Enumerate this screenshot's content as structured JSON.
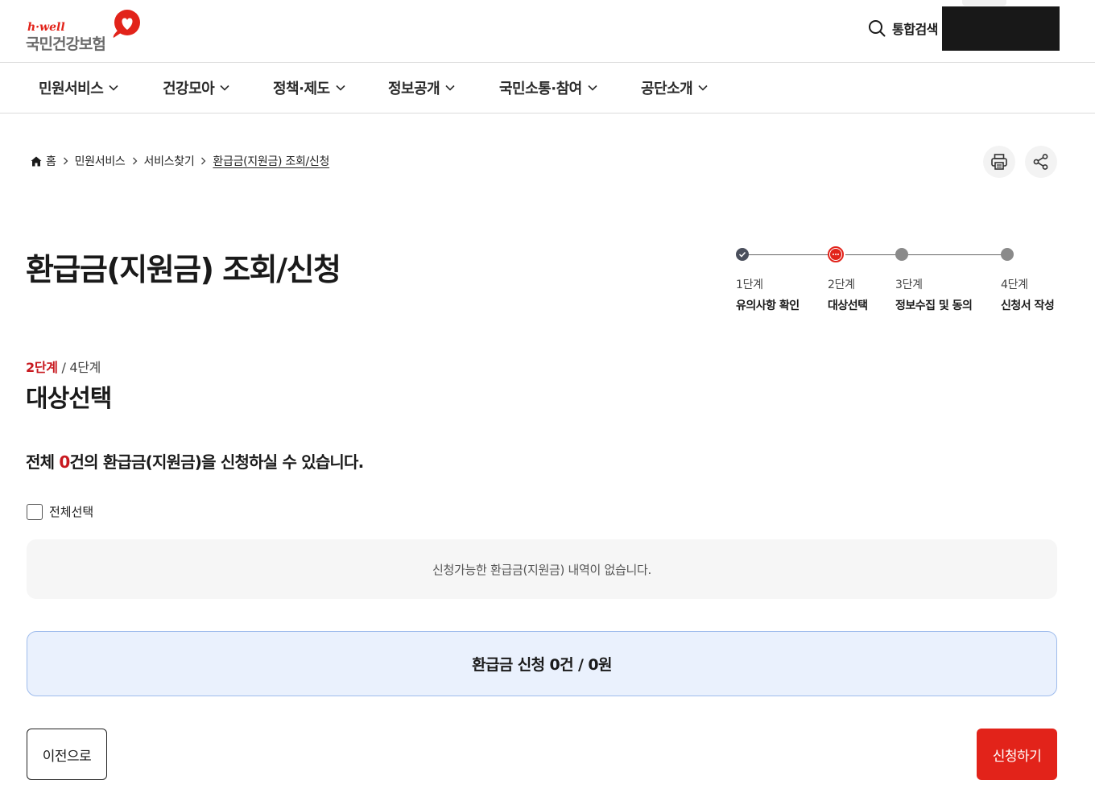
{
  "header": {
    "logo_en": "h·well",
    "logo_ko": "국민건강보험",
    "search_label": "통합검색",
    "accent_color": "#e2231a"
  },
  "gnb": {
    "items": [
      {
        "label": "민원서비스"
      },
      {
        "label": "건강모아"
      },
      {
        "label": "정책·제도"
      },
      {
        "label": "정보공개"
      },
      {
        "label": "국민소통·참여"
      },
      {
        "label": "공단소개"
      }
    ]
  },
  "breadcrumb": {
    "items": [
      "홈",
      "민원서비스",
      "서비스찾기",
      "환급금(지원금) 조회/신청"
    ]
  },
  "page": {
    "title": "환급금(지원금) 조회/신청"
  },
  "stepper": {
    "steps": [
      {
        "num": "1단계",
        "name": "유의사항 확인",
        "state": "done"
      },
      {
        "num": "2단계",
        "name": "대상선택",
        "state": "current"
      },
      {
        "num": "3단계",
        "name": "정보수집 및 동의",
        "state": "todo"
      },
      {
        "num": "4단계",
        "name": "신청서 작성",
        "state": "todo"
      }
    ]
  },
  "section": {
    "current_step": "2단계",
    "total_steps": " / 4단계",
    "title": "대상선택",
    "summary_prefix": "전체 ",
    "summary_count": "0",
    "summary_suffix": "건의 환급금(지원금)을 신청하실 수 있습니다.",
    "select_all_label": "전체선택",
    "empty_message": "신청가능한 환급금(지원금) 내역이 없습니다.",
    "total_text": "환급금 신청 0건 / 0원"
  },
  "actions": {
    "prev_label": "이전으로",
    "apply_label": "신청하기"
  },
  "icons": {
    "search": "search-icon",
    "home": "home-icon",
    "print": "print-icon",
    "share": "share-icon",
    "chevron": "chevron-down-icon"
  }
}
